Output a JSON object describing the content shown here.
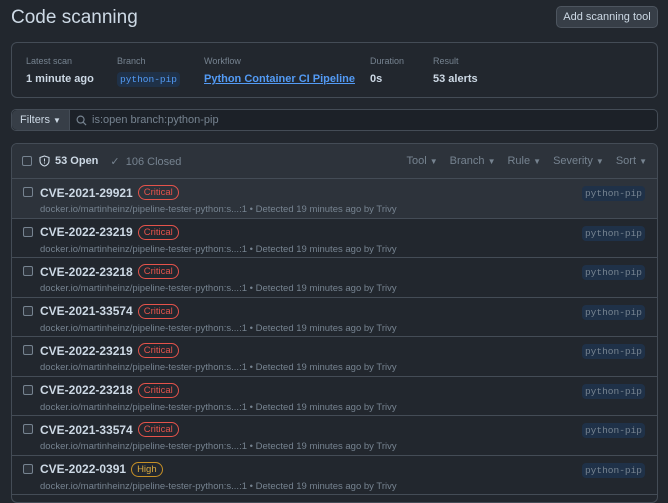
{
  "header": {
    "title": "Code scanning",
    "add_button": "Add scanning tool"
  },
  "summary": {
    "latest_scan_label": "Latest scan",
    "latest_scan": "1 minute ago",
    "branch_label": "Branch",
    "branch": "python-pip",
    "workflow_label": "Workflow",
    "workflow": "Python Container CI Pipeline",
    "duration_label": "Duration",
    "duration": "0s",
    "result_label": "Result",
    "result": "53 alerts"
  },
  "filters": {
    "button": "Filters",
    "query": "is:open branch:python-pip"
  },
  "list": {
    "open": "53 Open",
    "closed": "106 Closed",
    "sorts": [
      "Tool",
      "Branch",
      "Rule",
      "Severity",
      "Sort"
    ],
    "rows": [
      {
        "id": "CVE-2021-29921",
        "severity": "Critical",
        "meta": "docker.io/martinheinz/pipeline-tester-python:s...:1 • Detected 19 minutes ago by Trivy",
        "branch": "python-pip"
      },
      {
        "id": "CVE-2022-23219",
        "severity": "Critical",
        "meta": "docker.io/martinheinz/pipeline-tester-python:s...:1 • Detected 19 minutes ago by Trivy",
        "branch": "python-pip"
      },
      {
        "id": "CVE-2022-23218",
        "severity": "Critical",
        "meta": "docker.io/martinheinz/pipeline-tester-python:s...:1 • Detected 19 minutes ago by Trivy",
        "branch": "python-pip"
      },
      {
        "id": "CVE-2021-33574",
        "severity": "Critical",
        "meta": "docker.io/martinheinz/pipeline-tester-python:s...:1 • Detected 19 minutes ago by Trivy",
        "branch": "python-pip"
      },
      {
        "id": "CVE-2022-23219",
        "severity": "Critical",
        "meta": "docker.io/martinheinz/pipeline-tester-python:s...:1 • Detected 19 minutes ago by Trivy",
        "branch": "python-pip"
      },
      {
        "id": "CVE-2022-23218",
        "severity": "Critical",
        "meta": "docker.io/martinheinz/pipeline-tester-python:s...:1 • Detected 19 minutes ago by Trivy",
        "branch": "python-pip"
      },
      {
        "id": "CVE-2021-33574",
        "severity": "Critical",
        "meta": "docker.io/martinheinz/pipeline-tester-python:s...:1 • Detected 19 minutes ago by Trivy",
        "branch": "python-pip"
      },
      {
        "id": "CVE-2022-0391",
        "severity": "High",
        "meta": "docker.io/martinheinz/pipeline-tester-python:s...:1 • Detected 19 minutes ago by Trivy",
        "branch": "python-pip"
      }
    ]
  }
}
